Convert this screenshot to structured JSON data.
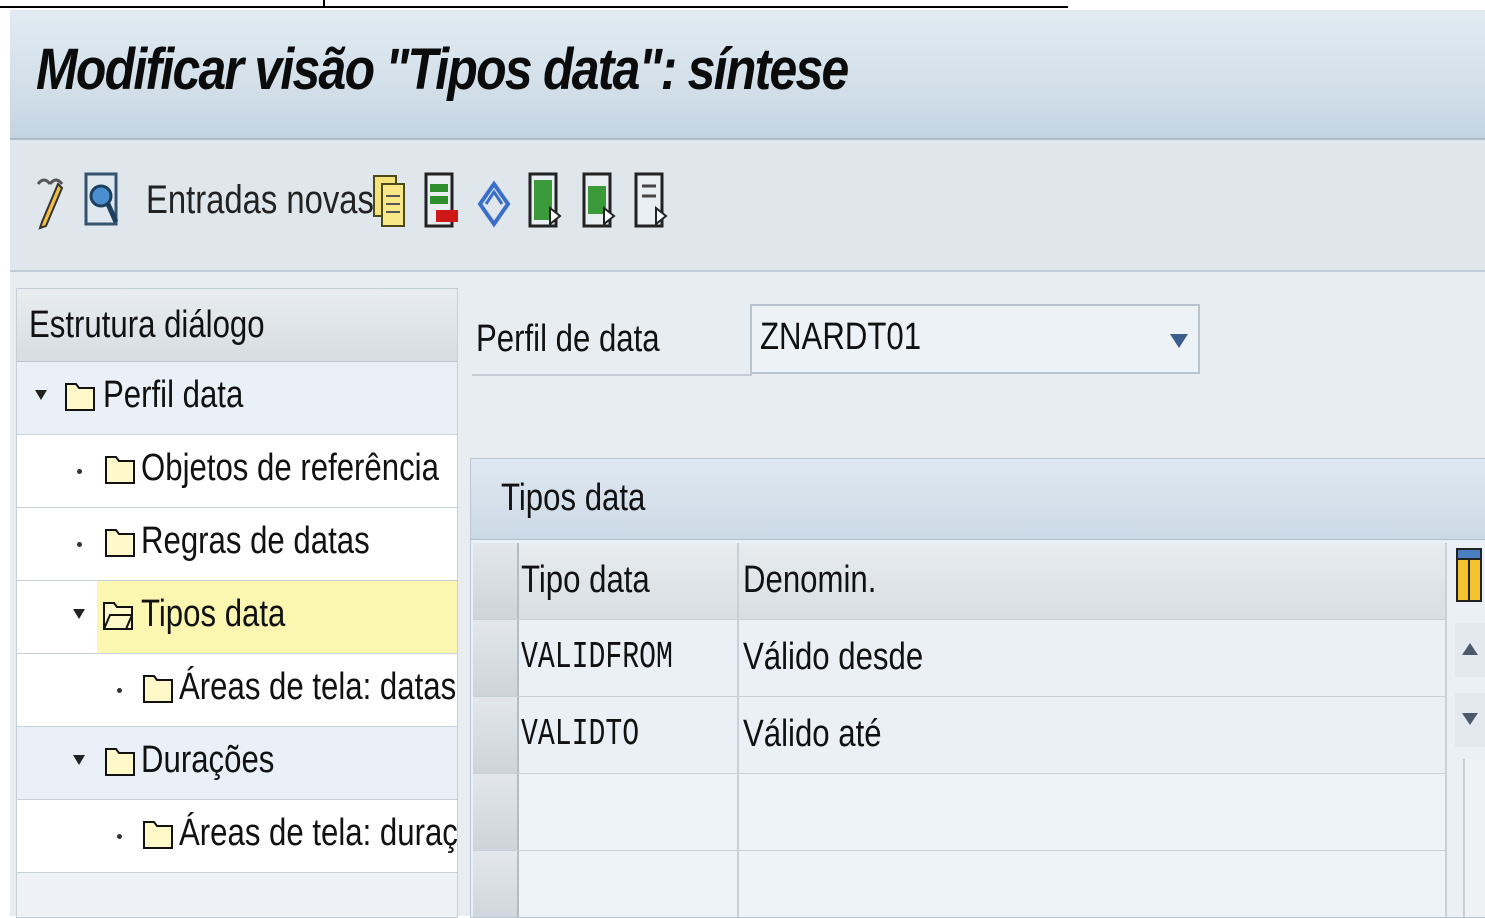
{
  "window": {
    "title": "Modificar visão \"Tipos data\": síntese"
  },
  "toolbar": {
    "new_entries_label": "Entradas novas",
    "icons": [
      "display-change-icon",
      "find-icon",
      "copy-as-icon",
      "delete-icon",
      "undo-change-icon",
      "select-all-icon",
      "select-block-icon",
      "deselect-all-icon"
    ]
  },
  "tree": {
    "header": "Estrutura diálogo",
    "items": [
      {
        "label": "Perfil data",
        "level": 0,
        "expanded": true
      },
      {
        "label": "Objetos de referência",
        "level": 1
      },
      {
        "label": "Regras de datas",
        "level": 1
      },
      {
        "label": "Tipos data",
        "level": 1,
        "expanded": true,
        "selected": true
      },
      {
        "label": "Áreas de tela: datas",
        "level": 2
      },
      {
        "label": "Durações",
        "level": 1,
        "expanded": true
      },
      {
        "label": "Áreas de tela: duraçõe",
        "level": 2
      }
    ]
  },
  "field": {
    "label": "Perfil de data",
    "value": "ZNARDT01"
  },
  "table": {
    "title": "Tipos data",
    "columns": [
      "Tipo data",
      "Denomin."
    ],
    "rows": [
      [
        "VALIDFROM",
        "Válido desde"
      ],
      [
        "VALIDTO",
        "Válido até"
      ],
      [
        "",
        ""
      ],
      [
        "",
        ""
      ]
    ]
  },
  "colors": {
    "title_bg": "#cfdde8",
    "selected_node": "#fbf7b0",
    "panel_bg": "#e8edf1"
  }
}
